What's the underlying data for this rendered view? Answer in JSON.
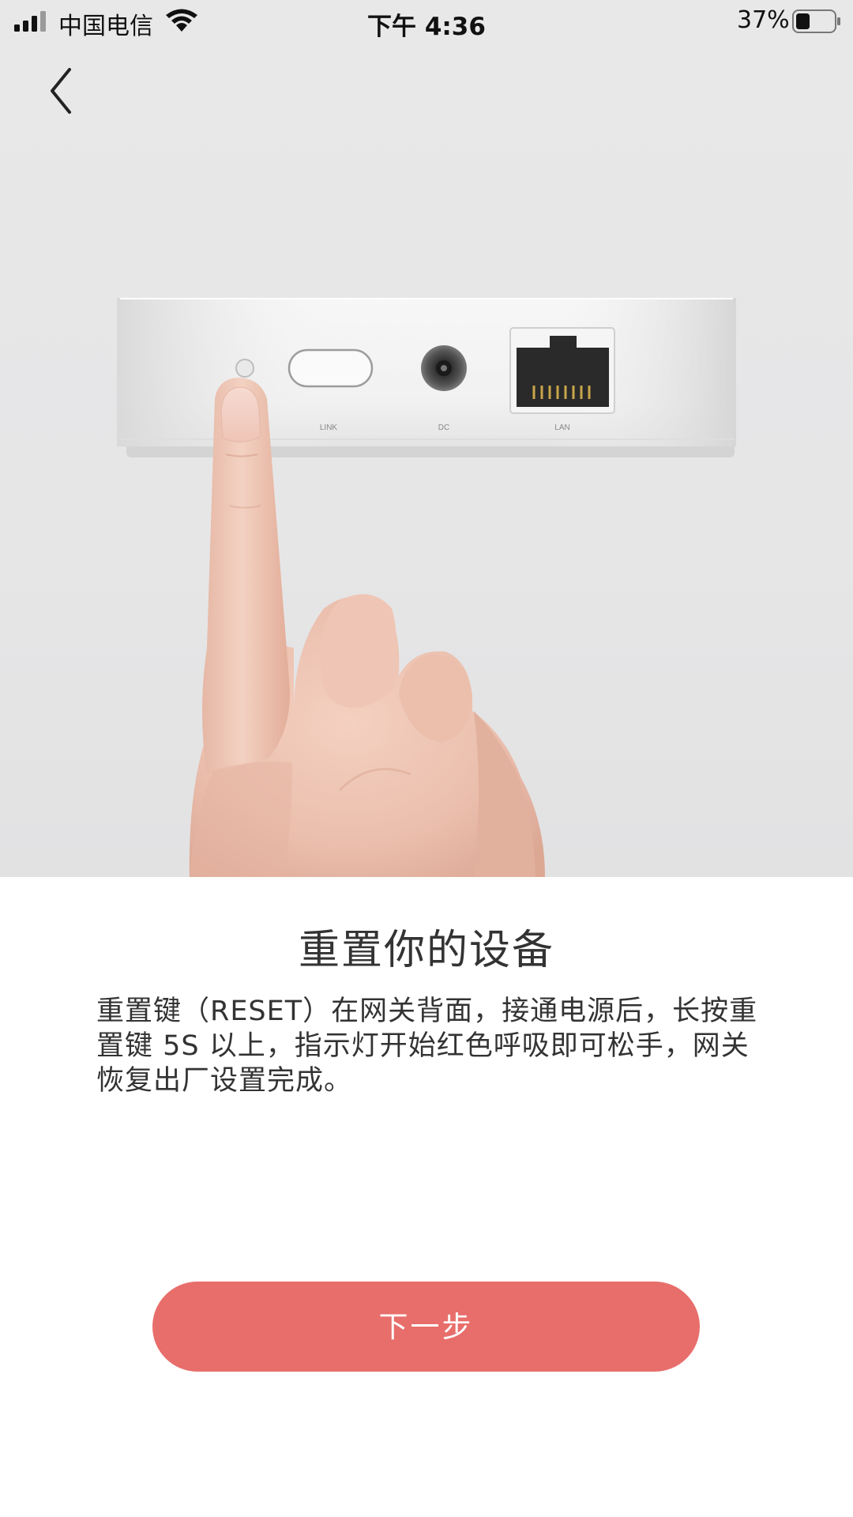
{
  "status_bar": {
    "carrier": "中国电信",
    "time": "下午 4:36",
    "battery_percent": "37%",
    "battery_level": 0.37
  },
  "nav": {
    "back_icon": "chevron-left-icon"
  },
  "illustration": {
    "port_labels": {
      "link": "LINK",
      "dc": "DC",
      "lan": "LAN"
    }
  },
  "content": {
    "title": "重置你的设备",
    "description": "重置键（RESET）在网关背面，接通电源后，长按重置键 5S 以上，指示灯开始红色呼吸即可松手，网关恢复出厂设置完成。"
  },
  "actions": {
    "next_label": "下一步",
    "accent_color": "#e86e6b"
  }
}
